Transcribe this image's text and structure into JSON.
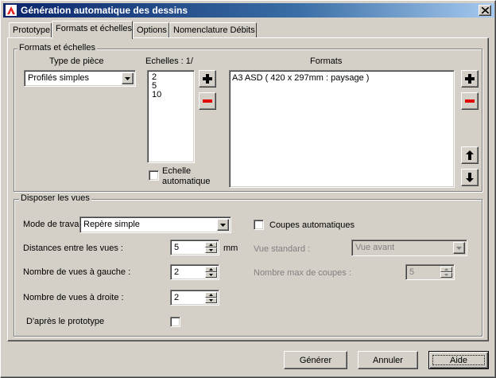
{
  "window": {
    "title": "Génération automatique des dessins"
  },
  "tabs": [
    {
      "label": "Prototype",
      "active": false
    },
    {
      "label": "Formats et échelles",
      "active": true
    },
    {
      "label": "Options",
      "active": false
    },
    {
      "label": "Nomenclature Débits",
      "active": false
    }
  ],
  "formats_group": {
    "legend": "Formats et échelles",
    "type_piece": {
      "label": "Type de pièce",
      "value": "Profilés simples"
    },
    "echelles": {
      "label": "Echelles : 1/",
      "items": [
        "2",
        "5",
        "10"
      ]
    },
    "echelle_auto": {
      "line1": "Echelle",
      "line2": "automatique",
      "checked": false
    },
    "formats": {
      "label": "Formats",
      "items": [
        "A3 ASD ( 420 x 297mm : paysage )"
      ]
    }
  },
  "vues_group": {
    "legend": "Disposer les vues",
    "mode_travail": {
      "label": "Mode de travai",
      "value": "Repère simple"
    },
    "distances": {
      "label": "Distances entre les vues :",
      "value": "5",
      "unit": "mm"
    },
    "vues_gauche": {
      "label": "Nombre de vues à gauche :",
      "value": "2"
    },
    "vues_droite": {
      "label": "Nombre de vues à droite :",
      "value": "2"
    },
    "prototype": {
      "label": "D'après le prototype",
      "checked": false
    },
    "coupes_auto": {
      "label": "Coupes automatiques",
      "checked": false
    },
    "vue_standard": {
      "label": "Vue standard :",
      "value": "Vue avant"
    },
    "max_coupes": {
      "label": "Nombre max de coupes :",
      "value": "5"
    }
  },
  "buttons": {
    "generer": "Générer",
    "annuler": "Annuler",
    "aide": "Aide"
  },
  "colors": {
    "title_start": "#0a246a",
    "title_end": "#a6caf0",
    "face": "#d4d0c8",
    "add_icon": "#000000",
    "remove_icon": "#e00000"
  }
}
